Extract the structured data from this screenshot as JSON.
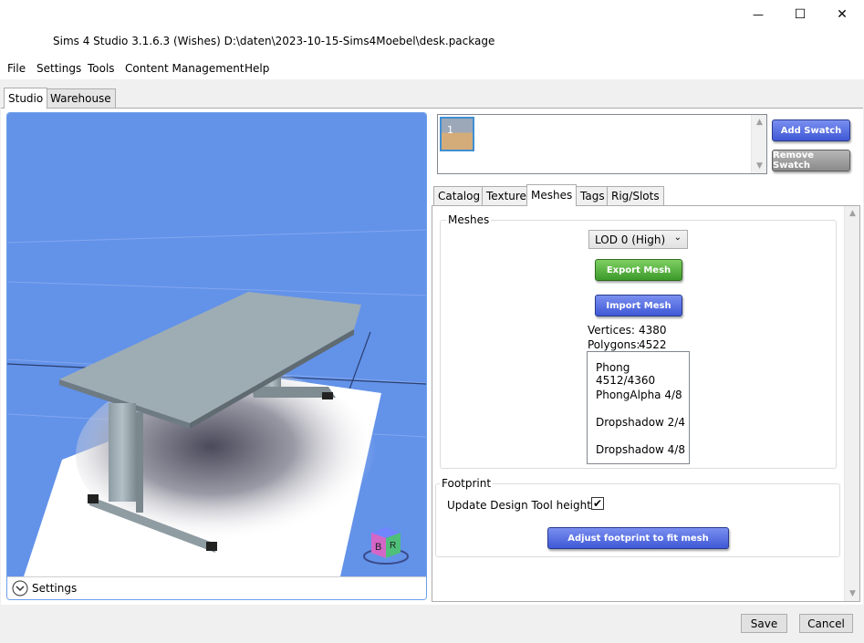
{
  "window": {
    "title": "Sims 4 Studio 3.1.6.3 (Wishes)  D:\\daten\\2023-10-15-Sims4Moebel\\desk.package",
    "minimize_glyph": "—",
    "maximize_glyph": "☐",
    "close_glyph": "✕"
  },
  "menu": [
    "File",
    "Settings",
    "Tools",
    "Content Management",
    "Help"
  ],
  "main_tabs": [
    "Studio",
    "Warehouse"
  ],
  "viewport": {
    "settings_label": "Settings",
    "cube_letters": [
      "B",
      "R"
    ]
  },
  "swatches": {
    "items": [
      "1"
    ],
    "add_label": "Add Swatch",
    "remove_label": "Remove Swatch"
  },
  "sub_tabs": [
    "Catalog",
    "Texture",
    "Meshes",
    "Tags",
    "Rig/Slots"
  ],
  "meshes": {
    "group_title": "Meshes",
    "lod_selected": "LOD 0 (High)",
    "export_label": "Export Mesh",
    "import_label": "Import Mesh",
    "vertices_label": "Vertices:",
    "vertices_value": "4380",
    "polygons_label": "Polygons:",
    "polygons_value": "4522",
    "groups": [
      "Phong 4512/4360",
      "PhongAlpha 4/8",
      "Dropshadow 2/4",
      "Dropshadow 4/8"
    ]
  },
  "footprint": {
    "group_title": "Footprint",
    "update_label": "Update Design Tool height",
    "update_checked": true,
    "check_glyph": "✔",
    "adjust_label": "Adjust footprint to fit mesh"
  },
  "footer": {
    "save_label": "Save",
    "cancel_label": "Cancel"
  },
  "colors": {
    "viewport_bg": "#6392e9",
    "blue_button": "#4a64db",
    "green_button": "#4caf3a",
    "gray_button": "#9a9a9a"
  }
}
